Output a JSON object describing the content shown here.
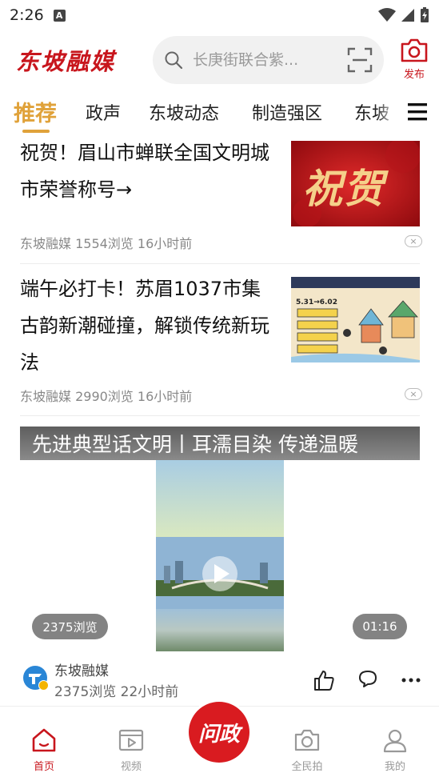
{
  "status": {
    "time": "2:26",
    "notification": "A"
  },
  "header": {
    "logo": "东坡融媒",
    "search_placeholder": "长庚街联合紫...",
    "publish_label": "发布"
  },
  "tabs": [
    {
      "label": "推荐"
    },
    {
      "label": "政声"
    },
    {
      "label": "东坡动态"
    },
    {
      "label": "制造强区"
    },
    {
      "label": "东坡"
    }
  ],
  "news": [
    {
      "title": "祝贺！眉山市蝉联全国文明城市荣誉称号→",
      "meta": "东坡融媒 1554浏览 16小时前",
      "thumb_text": "祝贺",
      "dismiss": "×"
    },
    {
      "title": "端午必打卡！苏眉1037市集古韵新潮碰撞，解锁传统新玩法",
      "meta": "东坡融媒 2990浏览 16小时前",
      "thumb_text": "5.31→6.02",
      "dismiss": "×"
    }
  ],
  "video": {
    "title": "先进典型话文明丨耳濡目染 传递温暖",
    "views_pill": "2375浏览",
    "duration": "01:16",
    "source": "东坡融媒",
    "stats": "2375浏览 22小时前"
  },
  "bottom_nav": {
    "home": "首页",
    "video": "视频",
    "center": "问政",
    "citizen": "全民拍",
    "mine": "我的"
  },
  "colors": {
    "brand_red": "#c8161d",
    "tab_active": "#e0a23a"
  }
}
